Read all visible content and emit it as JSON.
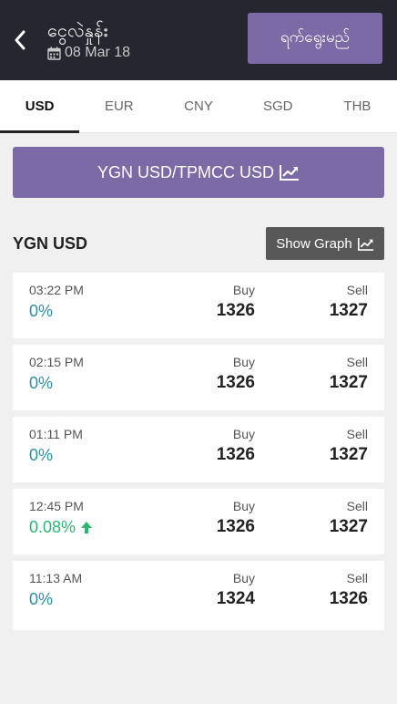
{
  "header": {
    "title": "ငွေလဲနှုန်း",
    "date": "08 Mar 18",
    "date_button_label": "ရက်ရွေးမည်"
  },
  "tabs": [
    {
      "label": "USD",
      "active": true
    },
    {
      "label": "EUR",
      "active": false
    },
    {
      "label": "CNY",
      "active": false
    },
    {
      "label": "SGD",
      "active": false
    },
    {
      "label": "THB",
      "active": false
    }
  ],
  "banner": {
    "label": "YGN USD/TPMCC USD",
    "icon": "line-chart-icon"
  },
  "section": {
    "title": "YGN USD",
    "graph_button_label": "Show Graph",
    "graph_button_icon": "line-chart-icon"
  },
  "rates": [
    {
      "time": "03:22 PM",
      "change": "0%",
      "buy_label": "Buy",
      "buy": "1326",
      "sell_label": "Sell",
      "sell": "1327"
    },
    {
      "time": "02:15 PM",
      "change": "0%",
      "buy_label": "Buy",
      "buy": "1326",
      "sell_label": "Sell",
      "sell": "1327"
    },
    {
      "time": "01:11 PM",
      "change": "0%",
      "buy_label": "Buy",
      "buy": "1326",
      "sell_label": "Sell",
      "sell": "1327"
    },
    {
      "time": "12:45 PM",
      "change": "0.08%",
      "trend": "up",
      "buy_label": "Buy",
      "buy": "1326",
      "sell_label": "Sell",
      "sell": "1327"
    },
    {
      "time": "11:13 AM",
      "change": "0%",
      "buy_label": "Buy",
      "buy": "1324",
      "sell_label": "Sell",
      "sell": "1326"
    }
  ],
  "colors": {
    "header_bg": "#262630",
    "accent": "#7b6aa6",
    "change_neutral": "#2b8fa6",
    "change_up": "#2bb673",
    "graph_button_bg": "#585858"
  }
}
